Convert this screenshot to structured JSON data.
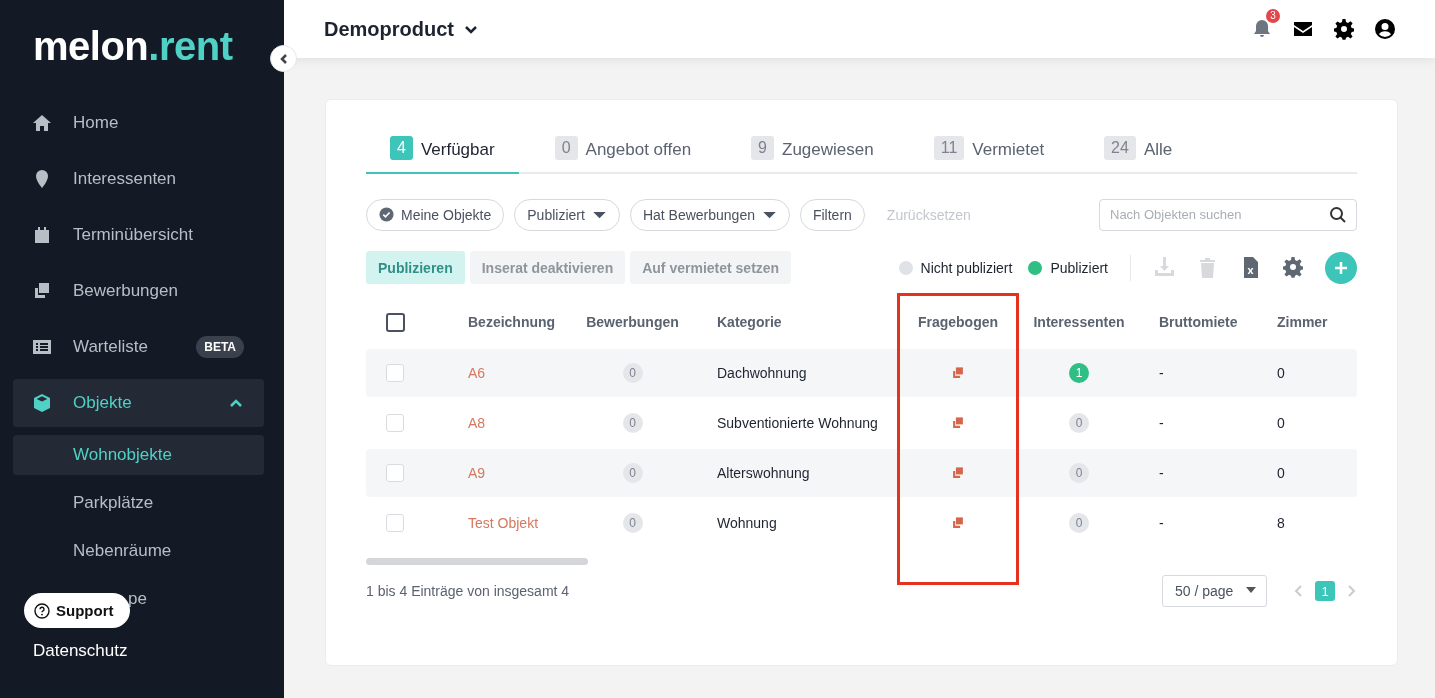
{
  "sidebar": {
    "logo": "melon",
    "logo_accent": ".rent",
    "items": [
      {
        "label": "Home",
        "kind": "home",
        "selected": false
      },
      {
        "label": "Interessenten",
        "kind": "pin",
        "selected": false
      },
      {
        "label": "Terminübersicht",
        "kind": "calendar",
        "selected": false
      },
      {
        "label": "Bewerbungen",
        "kind": "copy",
        "selected": false
      },
      {
        "label": "Warteliste",
        "kind": "list",
        "selected": false,
        "badge": "BETA"
      },
      {
        "label": "Objekte",
        "kind": "cube",
        "selected": true,
        "expanded": true,
        "children": [
          {
            "label": "Wohnobjekte",
            "selected": true
          },
          {
            "label": "Parkplätze",
            "selected": false
          },
          {
            "label": "Nebenräume",
            "selected": false
          },
          {
            "label": "pe",
            "selected": false
          }
        ]
      }
    ],
    "support": "Support",
    "footer_link": "Datenschutz"
  },
  "header": {
    "product": "Demoproduct",
    "notification_count": "3"
  },
  "tabs": [
    {
      "count": "4",
      "label": "Verfügbar",
      "selected": true
    },
    {
      "count": "0",
      "label": "Angebot offen",
      "selected": false
    },
    {
      "count": "9",
      "label": "Zugewiesen",
      "selected": false
    },
    {
      "count": "11",
      "label": "Vermietet",
      "selected": false
    },
    {
      "count": "24",
      "label": "Alle",
      "selected": false
    }
  ],
  "filters": [
    {
      "label": "Meine Objekte",
      "kind": "check"
    },
    {
      "label": "Publiziert",
      "kind": "dropdown"
    },
    {
      "label": "Hat Bewerbungen",
      "kind": "dropdown"
    },
    {
      "label": "Filtern",
      "kind": "plain"
    },
    {
      "label": "Zurücksetzen",
      "kind": "link",
      "disabled": true
    }
  ],
  "search": {
    "placeholder": "Nach Objekten suchen"
  },
  "actions": [
    {
      "label": "Publizieren",
      "kind": "primary",
      "disabled": true
    },
    {
      "label": "Inserat deaktivieren",
      "kind": "default",
      "disabled": true
    },
    {
      "label": "Auf vermietet setzen",
      "kind": "default",
      "disabled": true
    }
  ],
  "legend": [
    {
      "label": "Nicht publiziert",
      "color": "#dfe2e6"
    },
    {
      "label": "Publiziert",
      "color": "#2fbf85"
    }
  ],
  "tools": [
    {
      "kind": "download",
      "disabled": true
    },
    {
      "kind": "trash",
      "disabled": true
    },
    {
      "kind": "excel",
      "disabled": false
    },
    {
      "kind": "settings",
      "disabled": false
    },
    {
      "kind": "add",
      "disabled": false
    }
  ],
  "table": {
    "select_all_checked": false,
    "columns": [
      {
        "label": "Bezeichnung",
        "highlighted": false
      },
      {
        "label": "Bewerbungen",
        "highlighted": false
      },
      {
        "label": "Kategorie",
        "highlighted": false
      },
      {
        "label": "Fragebogen",
        "highlighted": true
      },
      {
        "label": "Interessenten",
        "highlighted": false
      },
      {
        "label": "Bruttomiete",
        "highlighted": false
      },
      {
        "label": "Zimmer",
        "highlighted": false
      }
    ],
    "rows": [
      {
        "checked": false,
        "name": "A6",
        "applications": "0",
        "category": "Dachwohnung",
        "interested": "1",
        "interested_active": true,
        "rent": "-",
        "rooms": "0"
      },
      {
        "checked": false,
        "name": "A8",
        "applications": "0",
        "category": "Subventionierte Wohnung",
        "interested": "0",
        "interested_active": false,
        "rent": "-",
        "rooms": "0"
      },
      {
        "checked": false,
        "name": "A9",
        "applications": "0",
        "category": "Alterswohnung",
        "interested": "0",
        "interested_active": false,
        "rent": "-",
        "rooms": "0"
      },
      {
        "checked": false,
        "name": "Test Objekt",
        "applications": "0",
        "category": "Wohnung",
        "interested": "0",
        "interested_active": false,
        "rent": "-",
        "rooms": "8"
      }
    ]
  },
  "footer": {
    "summary": "1 bis 4 Einträge von insgesamt 4",
    "page_size": "50 / page",
    "pages": [
      {
        "label": "1",
        "selected": true
      }
    ]
  }
}
